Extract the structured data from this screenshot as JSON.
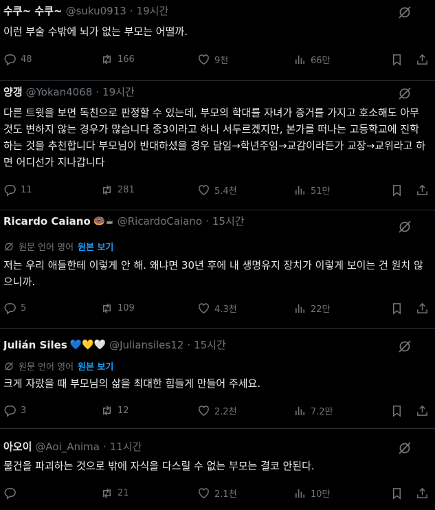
{
  "colors": {
    "background": "#000000",
    "text": "#e7e9ea",
    "muted": "#71767b",
    "link": "#1d9bf0",
    "divider": "#2f3336"
  },
  "icons": {
    "reply": "reply-icon",
    "retweet": "retweet-icon",
    "like": "heart-icon",
    "views": "views-chart-icon",
    "bookmark": "bookmark-icon",
    "share": "share-icon",
    "grok": "grok-icon",
    "translate": "translate-icon"
  },
  "posts": [
    {
      "name": "수쿠~ 수쿠~",
      "emoji": "",
      "handle": "@suku0913",
      "time": "19시간",
      "text": "이런 부술 수밖에 뇌가 없는 부모는 어떨까.",
      "replies": "48",
      "reposts": "166",
      "likes": "9천",
      "views": "66만"
    },
    {
      "name": "양갱",
      "emoji": "",
      "handle": "@Yokan4068",
      "time": "19시간",
      "text": "다른 트윗을 보면 독친으로 판정할 수 있는데, 부모의 학대를 자녀가 증거를 가지고 호소해도 아무것도 변하지 않는 경우가 많습니다 중3이라고 하니 서두르겠지만, 본가를 떠나는 고등학교에 진학하는 것을 추천합니다 부모님이 반대하셨을 경우 담임→학년주임→교감이라든가 교장→교위라고 하면 어디선가 지나갑니다",
      "replies": "11",
      "reposts": "281",
      "likes": "5.4천",
      "views": "51만"
    },
    {
      "name": "Ricardo Caiano",
      "emoji": "🍩☕",
      "handle": "@RicardoCaiano",
      "time": "15시간",
      "translate": {
        "label": "원문 언어 영어",
        "link": "원본 보기"
      },
      "text": "저는 우리 애들한테 이렇게 안 해. 왜냐면 30년 후에 내 생명유지 장치가 이렇게 보이는 건 원치 않으니까.",
      "replies": "5",
      "reposts": "109",
      "likes": "4.3천",
      "views": "22만"
    },
    {
      "name": "Julián Siles",
      "emoji": "💙💛🤍",
      "handle": "@Juliansiles12",
      "time": "15시간",
      "translate": {
        "label": "원문 언어 영어",
        "link": "원본 보기"
      },
      "text": "크게 자랐을 때 부모님의 삶을 최대한 힘들게 만들어 주세요.",
      "replies": "3",
      "reposts": "12",
      "likes": "2.2천",
      "views": "7.2만"
    },
    {
      "name": "아오이",
      "emoji": "",
      "handle": "@Aoi_Anima",
      "time": "11시간",
      "text": "물건을 파괴하는 것으로 밖에 자식을 다스릴 수 없는 부모는 결코 안된다.",
      "replies": "",
      "reposts": "21",
      "likes": "2.1천",
      "views": "10만"
    }
  ]
}
